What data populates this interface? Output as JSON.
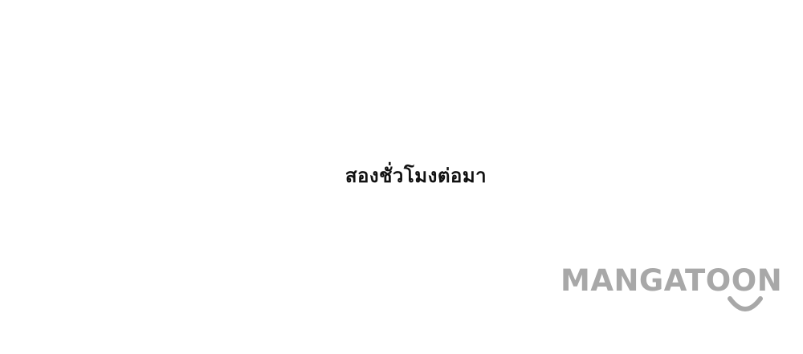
{
  "panel": {
    "caption": "สองชั่วโมงต่อมา"
  },
  "watermark": {
    "text": "MANGATOON",
    "color": "#a8a8a8"
  }
}
